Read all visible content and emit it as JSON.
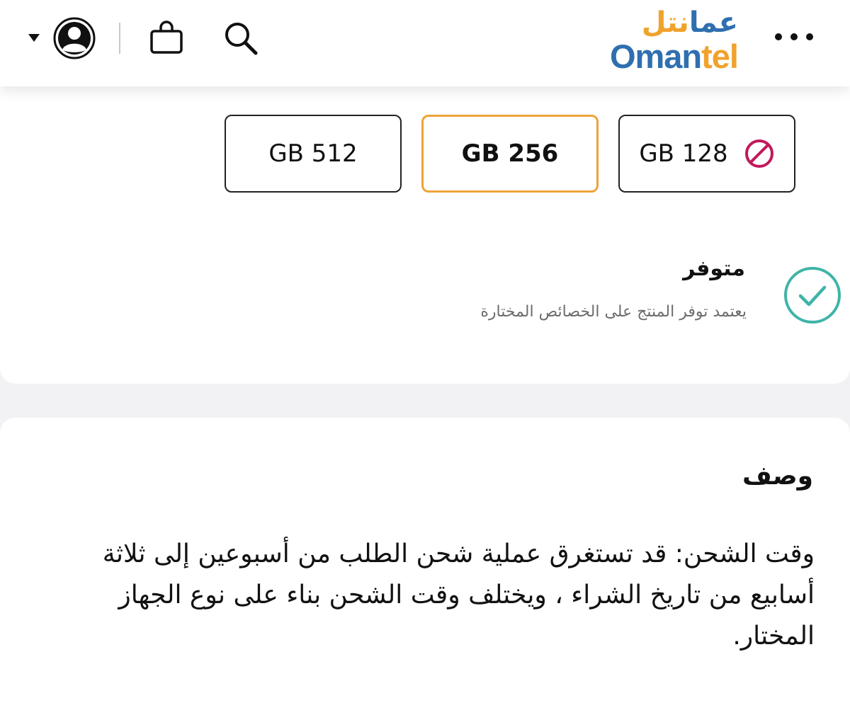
{
  "header": {
    "logo": {
      "arabic": "عمانتل",
      "english": "Omantel",
      "colors": {
        "blue": "#2f6fb0",
        "orange": "#f0a22c"
      }
    },
    "icons": [
      "more-options-icon",
      "search-icon",
      "shopping-bag-icon",
      "user-avatar-icon",
      "dropdown-caret-icon"
    ]
  },
  "storage": {
    "options": [
      {
        "label": "GB 512",
        "selected": false,
        "available": true
      },
      {
        "label": "GB 256",
        "selected": true,
        "available": true
      },
      {
        "label": "GB 128",
        "selected": false,
        "available": false,
        "status_icon": "unavailable-icon"
      }
    ],
    "selected_color": "#eea33a",
    "unavailable_color": "#c2185b"
  },
  "availability": {
    "status": "متوفر",
    "note": "يعتمد توفر المنتج على الخصائص المختارة",
    "icon": "check-circle-icon",
    "icon_color": "#3fb4a8"
  },
  "description": {
    "title": "وصف",
    "body": "وقت الشحن: قد تستغرق عملية شحن الطلب من أسبوعين إلى ثلاثة أسابيع من تاريخ الشراء ، ويختلف وقت الشحن بناء على نوع الجهاز المختار."
  }
}
